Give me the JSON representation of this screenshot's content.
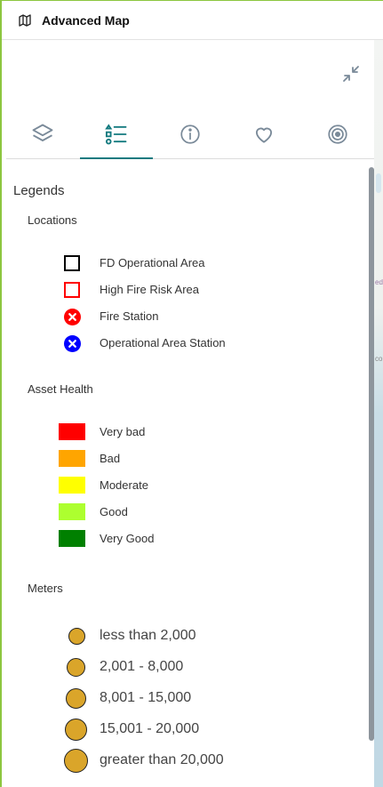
{
  "header": {
    "title": "Advanced Map",
    "icon": "map-icon"
  },
  "tabs": [
    {
      "name": "layers",
      "icon": "layers-icon",
      "active": false
    },
    {
      "name": "legend",
      "icon": "legend-list-icon",
      "active": true
    },
    {
      "name": "info",
      "icon": "info-icon",
      "active": false
    },
    {
      "name": "favorites",
      "icon": "heart-icon",
      "active": false
    },
    {
      "name": "target",
      "icon": "target-icon",
      "active": false
    }
  ],
  "legend": {
    "title": "Legends",
    "locations": {
      "title": "Locations",
      "items": [
        {
          "label": "FD Operational Area",
          "symbol": "square-outline",
          "color": "#000000"
        },
        {
          "label": "High Fire Risk Area",
          "symbol": "square-outline",
          "color": "#ff0000"
        },
        {
          "label": "Fire Station",
          "symbol": "circle-x",
          "color": "#ff0000"
        },
        {
          "label": "Operational Area Station",
          "symbol": "circle-x",
          "color": "#0000ff"
        }
      ]
    },
    "asset_health": {
      "title": "Asset Health",
      "items": [
        {
          "label": "Very bad",
          "color": "#ff0000"
        },
        {
          "label": "Bad",
          "color": "#ffa500"
        },
        {
          "label": "Moderate",
          "color": "#ffff00"
        },
        {
          "label": "Good",
          "color": "#adff2f"
        },
        {
          "label": "Very Good",
          "color": "#008000"
        }
      ]
    },
    "meters": {
      "title": "Meters",
      "color": "#daa52a",
      "items": [
        {
          "label": "less than 2,000"
        },
        {
          "label": "2,001 - 8,000"
        },
        {
          "label": "8,001 - 15,000"
        },
        {
          "label": "15,001 - 20,000"
        },
        {
          "label": "greater than 20,000"
        }
      ]
    }
  },
  "colors": {
    "accent": "#137a7f",
    "icon_gray": "#7a8a99"
  }
}
